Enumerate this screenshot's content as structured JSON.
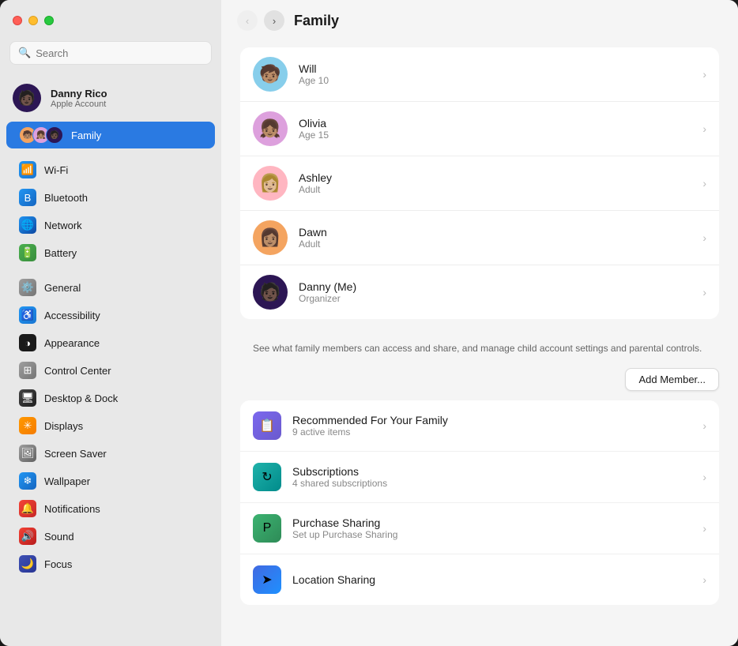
{
  "window": {
    "title": "Family"
  },
  "titlebar": {
    "close": "close",
    "minimize": "minimize",
    "maximize": "maximize"
  },
  "sidebar": {
    "search_placeholder": "Search",
    "account": {
      "name": "Danny Rico",
      "subtitle": "Apple Account",
      "avatar_emoji": "🧑🏿"
    },
    "family_item": {
      "label": "Family"
    },
    "items": [
      {
        "id": "wifi",
        "label": "Wi-Fi",
        "icon": "📶",
        "icon_class": "icon-wifi"
      },
      {
        "id": "bluetooth",
        "label": "Bluetooth",
        "icon": "B",
        "icon_class": "icon-bluetooth"
      },
      {
        "id": "network",
        "label": "Network",
        "icon": "🌐",
        "icon_class": "icon-network"
      },
      {
        "id": "battery",
        "label": "Battery",
        "icon": "🔋",
        "icon_class": "icon-battery"
      },
      {
        "id": "general",
        "label": "General",
        "icon": "⚙️",
        "icon_class": "icon-general"
      },
      {
        "id": "accessibility",
        "label": "Accessibility",
        "icon": "♿",
        "icon_class": "icon-accessibility"
      },
      {
        "id": "appearance",
        "label": "Appearance",
        "icon": "◑",
        "icon_class": "icon-appearance"
      },
      {
        "id": "control",
        "label": "Control Center",
        "icon": "⊞",
        "icon_class": "icon-control"
      },
      {
        "id": "desktop",
        "label": "Desktop & Dock",
        "icon": "🖥",
        "icon_class": "icon-desktop"
      },
      {
        "id": "displays",
        "label": "Displays",
        "icon": "✳",
        "icon_class": "icon-displays"
      },
      {
        "id": "screensaver",
        "label": "Screen Saver",
        "icon": "🖼",
        "icon_class": "icon-screensaver"
      },
      {
        "id": "wallpaper",
        "label": "Wallpaper",
        "icon": "❄",
        "icon_class": "icon-wallpaper"
      },
      {
        "id": "notifications",
        "label": "Notifications",
        "icon": "🔔",
        "icon_class": "icon-notifications"
      },
      {
        "id": "sound",
        "label": "Sound",
        "icon": "🔊",
        "icon_class": "icon-sound"
      },
      {
        "id": "focus",
        "label": "Focus",
        "icon": "🌙",
        "icon_class": "icon-focus"
      }
    ]
  },
  "main": {
    "title": "Family",
    "members": [
      {
        "name": "Will",
        "subtitle": "Age 10",
        "emoji": "🧒🏽",
        "av_class": "av-will"
      },
      {
        "name": "Olivia",
        "subtitle": "Age 15",
        "emoji": "👧🏽",
        "av_class": "av-olivia"
      },
      {
        "name": "Ashley",
        "subtitle": "Adult",
        "emoji": "👩🏼",
        "av_class": "av-ashley"
      },
      {
        "name": "Dawn",
        "subtitle": "Adult",
        "emoji": "👩🏽",
        "av_class": "av-dawn"
      },
      {
        "name": "Danny (Me)",
        "subtitle": "Organizer",
        "emoji": "🧑🏿",
        "av_class": "av-danny"
      }
    ],
    "description": "See what family members can access and share, and manage child account settings and parental controls.",
    "add_member_label": "Add Member...",
    "features": [
      {
        "id": "recommended",
        "title": "Recommended For Your Family",
        "subtitle": "9 active items",
        "icon": "📋",
        "icon_class": "icon-recommended"
      },
      {
        "id": "subscriptions",
        "title": "Subscriptions",
        "subtitle": "4 shared subscriptions",
        "icon": "↻",
        "icon_class": "icon-subscriptions"
      },
      {
        "id": "purchase",
        "title": "Purchase Sharing",
        "subtitle": "Set up Purchase Sharing",
        "icon": "P",
        "icon_class": "icon-purchase"
      },
      {
        "id": "location",
        "title": "Location Sharing",
        "subtitle": "",
        "icon": "➤",
        "icon_class": "icon-location"
      }
    ]
  }
}
